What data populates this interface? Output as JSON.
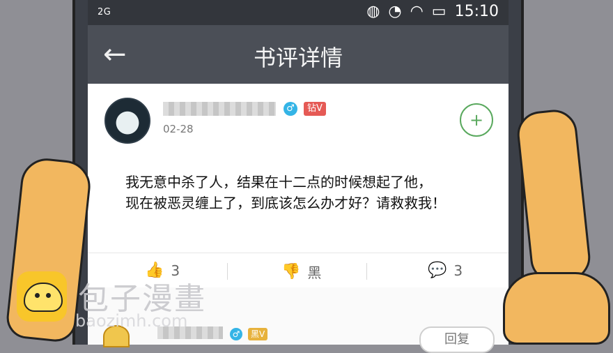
{
  "status_bar": {
    "network": "2G",
    "time": "15:10"
  },
  "header": {
    "title": "书评详情",
    "back_icon": "left-arrow-icon"
  },
  "post": {
    "date": "02-28",
    "vip_badge": "钻V",
    "lines": [
      "我无意中杀了人，结果在十二点的时候想起了他，",
      "现在被恶灵缠上了，到底该怎么办才好？请救救我！"
    ]
  },
  "actions": {
    "like_count": "3",
    "dislike_label": "黑",
    "comment_count": "3"
  },
  "reply": {
    "vip_badge": "黑V",
    "button": "回复"
  },
  "watermark": {
    "cn": "包子漫畫",
    "en": "baozimh.com"
  },
  "colors": {
    "topbar": "#4b4f57",
    "follow": "#5aa95e",
    "badge_red": "#e55a55",
    "badge_gold": "#e7b23c",
    "gender_blue": "#34b4e6"
  }
}
